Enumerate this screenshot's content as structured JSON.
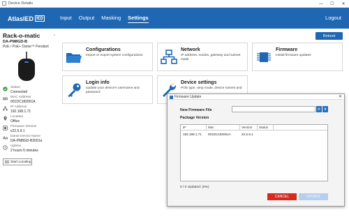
{
  "window": {
    "title": "Device Details",
    "controls": [
      "—",
      "☐",
      "✕"
    ]
  },
  "nav": {
    "logo_text": "AtlasIED",
    "logo_mark": "IED",
    "tabs": [
      {
        "label": "Input",
        "active": false
      },
      {
        "label": "Output",
        "active": false
      },
      {
        "label": "Masking",
        "active": false
      },
      {
        "label": "Settings",
        "active": true
      }
    ],
    "logout": "Logout"
  },
  "device": {
    "name": "Rack-o-matic",
    "model": "DA-PM8GD-B",
    "description": "PoE / PoE+ Dante™ Pendant",
    "collapse": "‹",
    "info": [
      {
        "icon": "status-check-icon",
        "label": "Status",
        "value": "Connected"
      },
      {
        "icon": "mac-address-icon",
        "label": "MAC Address",
        "value": "001DC182001A"
      },
      {
        "icon": "ip-address-icon",
        "label": "IP Address",
        "value": "192.168.1.71"
      },
      {
        "icon": "location-pin-icon",
        "label": "Location",
        "value": "Office"
      },
      {
        "icon": "firmware-version-icon",
        "label": "Firmware Version",
        "value": "v22.5.9.1"
      },
      {
        "icon": "dante-name-icon",
        "label": "Dante Device Name",
        "value": "DA-PM8GD-B2001a"
      },
      {
        "icon": "uptime-clock-icon",
        "label": "Uptime",
        "value": "2 hours 6 minutes"
      }
    ],
    "start_locating": "Start Locating"
  },
  "actions": {
    "reboot": "Reboot"
  },
  "cards": [
    {
      "icon": "folder-icon",
      "title": "Configurations",
      "desc": "Import or export system configurations"
    },
    {
      "icon": "network-icon",
      "title": "Network",
      "desc": "IP address, modes, gateway and subnet mask"
    },
    {
      "icon": "firmware-chip-icon",
      "title": "Firmware",
      "desc": "Install firmware updates"
    },
    {
      "icon": "key-icon",
      "title": "Login info",
      "desc": "Update your device's username and password"
    },
    {
      "icon": "wrench-icon",
      "title": "Device settings",
      "desc": "POE type, amp mode, device names and"
    }
  ],
  "dialog": {
    "title": "Firmware Update",
    "close": "✕",
    "new_firmware_label": "New Firmware File",
    "new_firmware_value": "",
    "btn_browse": "⟳",
    "btn_upload": "⬆",
    "package_version_label": "Package Version",
    "table": {
      "columns": [
        "IP",
        "Mac",
        "Version",
        "Status"
      ],
      "rows": [
        {
          "ip": "192.168.1.71",
          "mac": "001DC182001A",
          "version": "22.5.9.1",
          "status": ""
        }
      ]
    },
    "updated": "0 / 0 Updated: (0%)",
    "cancel": "CANCEL",
    "update": "UPDATE"
  },
  "colors": {
    "brand_blue": "#1f67b3",
    "cancel_red": "#d42b1e",
    "update_disabled": "#b5cfee"
  }
}
